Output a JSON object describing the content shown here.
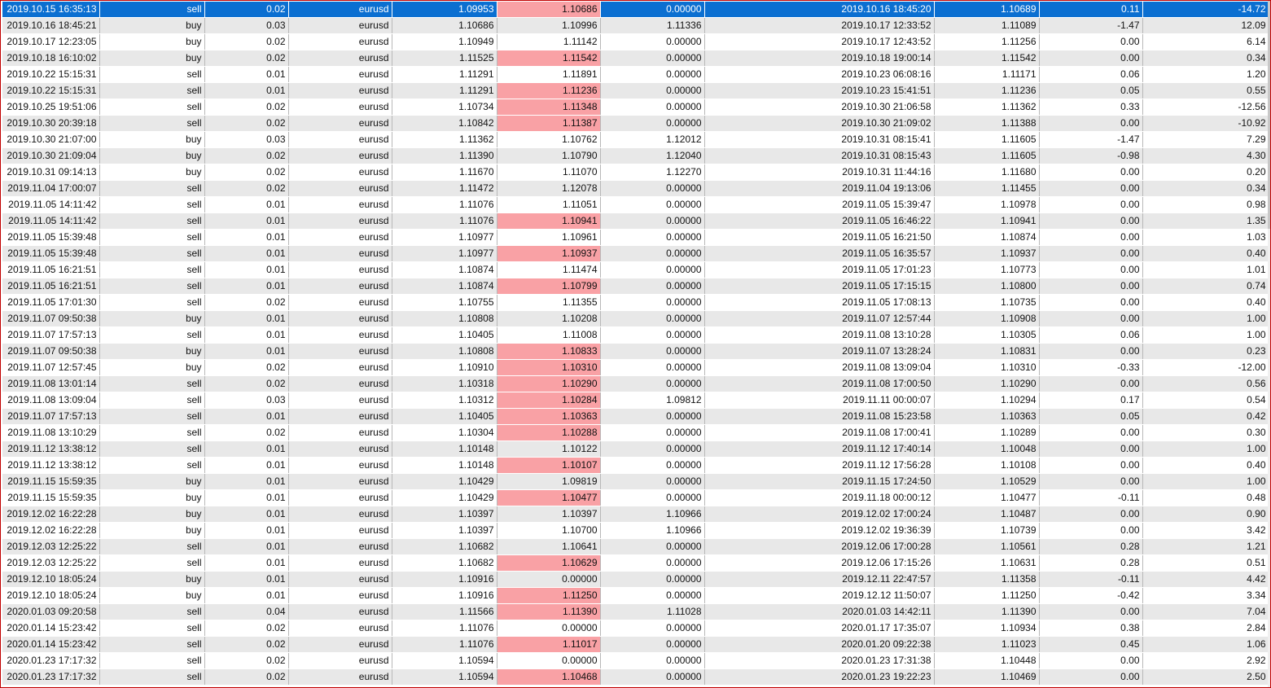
{
  "colors": {
    "selection": "#0b6fd1",
    "row_alt": "#e8e8e8",
    "row": "#ffffff",
    "highlight": "#f9a1a5",
    "frame": "#c00000"
  },
  "columns": [
    "open_time",
    "type",
    "volume",
    "symbol",
    "open_price",
    "sl",
    "tp",
    "close_time",
    "close_price",
    "swap",
    "profit"
  ],
  "selected_row": 0,
  "rows": [
    {
      "cells": [
        "2019.10.15 16:35:13",
        "sell",
        "0.02",
        "eurusd",
        "1.09953",
        "1.10686",
        "0.00000",
        "2019.10.16 18:45:20",
        "1.10689",
        "0.11",
        "-14.72"
      ],
      "hl": true
    },
    {
      "cells": [
        "2019.10.16 18:45:21",
        "buy",
        "0.03",
        "eurusd",
        "1.10686",
        "1.10996",
        "1.11336",
        "2019.10.17 12:33:52",
        "1.11089",
        "-1.47",
        "12.09"
      ],
      "hl": false
    },
    {
      "cells": [
        "2019.10.17 12:23:05",
        "buy",
        "0.02",
        "eurusd",
        "1.10949",
        "1.11142",
        "0.00000",
        "2019.10.17 12:43:52",
        "1.11256",
        "0.00",
        "6.14"
      ],
      "hl": false
    },
    {
      "cells": [
        "2019.10.18 16:10:02",
        "buy",
        "0.02",
        "eurusd",
        "1.11525",
        "1.11542",
        "0.00000",
        "2019.10.18 19:00:14",
        "1.11542",
        "0.00",
        "0.34"
      ],
      "hl": true
    },
    {
      "cells": [
        "2019.10.22 15:15:31",
        "sell",
        "0.01",
        "eurusd",
        "1.11291",
        "1.11891",
        "0.00000",
        "2019.10.23 06:08:16",
        "1.11171",
        "0.06",
        "1.20"
      ],
      "hl": false
    },
    {
      "cells": [
        "2019.10.22 15:15:31",
        "sell",
        "0.01",
        "eurusd",
        "1.11291",
        "1.11236",
        "0.00000",
        "2019.10.23 15:41:51",
        "1.11236",
        "0.05",
        "0.55"
      ],
      "hl": true
    },
    {
      "cells": [
        "2019.10.25 19:51:06",
        "sell",
        "0.02",
        "eurusd",
        "1.10734",
        "1.11348",
        "0.00000",
        "2019.10.30 21:06:58",
        "1.11362",
        "0.33",
        "-12.56"
      ],
      "hl": true
    },
    {
      "cells": [
        "2019.10.30 20:39:18",
        "sell",
        "0.02",
        "eurusd",
        "1.10842",
        "1.11387",
        "0.00000",
        "2019.10.30 21:09:02",
        "1.11388",
        "0.00",
        "-10.92"
      ],
      "hl": true
    },
    {
      "cells": [
        "2019.10.30 21:07:00",
        "buy",
        "0.03",
        "eurusd",
        "1.11362",
        "1.10762",
        "1.12012",
        "2019.10.31 08:15:41",
        "1.11605",
        "-1.47",
        "7.29"
      ],
      "hl": false
    },
    {
      "cells": [
        "2019.10.30 21:09:04",
        "buy",
        "0.02",
        "eurusd",
        "1.11390",
        "1.10790",
        "1.12040",
        "2019.10.31 08:15:43",
        "1.11605",
        "-0.98",
        "4.30"
      ],
      "hl": false
    },
    {
      "cells": [
        "2019.10.31 09:14:13",
        "buy",
        "0.02",
        "eurusd",
        "1.11670",
        "1.11070",
        "1.12270",
        "2019.10.31 11:44:16",
        "1.11680",
        "0.00",
        "0.20"
      ],
      "hl": false
    },
    {
      "cells": [
        "2019.11.04 17:00:07",
        "sell",
        "0.02",
        "eurusd",
        "1.11472",
        "1.12078",
        "0.00000",
        "2019.11.04 19:13:06",
        "1.11455",
        "0.00",
        "0.34"
      ],
      "hl": false
    },
    {
      "cells": [
        "2019.11.05 14:11:42",
        "sell",
        "0.01",
        "eurusd",
        "1.11076",
        "1.11051",
        "0.00000",
        "2019.11.05 15:39:47",
        "1.10978",
        "0.00",
        "0.98"
      ],
      "hl": false
    },
    {
      "cells": [
        "2019.11.05 14:11:42",
        "sell",
        "0.01",
        "eurusd",
        "1.11076",
        "1.10941",
        "0.00000",
        "2019.11.05 16:46:22",
        "1.10941",
        "0.00",
        "1.35"
      ],
      "hl": true
    },
    {
      "cells": [
        "2019.11.05 15:39:48",
        "sell",
        "0.01",
        "eurusd",
        "1.10977",
        "1.10961",
        "0.00000",
        "2019.11.05 16:21:50",
        "1.10874",
        "0.00",
        "1.03"
      ],
      "hl": false
    },
    {
      "cells": [
        "2019.11.05 15:39:48",
        "sell",
        "0.01",
        "eurusd",
        "1.10977",
        "1.10937",
        "0.00000",
        "2019.11.05 16:35:57",
        "1.10937",
        "0.00",
        "0.40"
      ],
      "hl": true
    },
    {
      "cells": [
        "2019.11.05 16:21:51",
        "sell",
        "0.01",
        "eurusd",
        "1.10874",
        "1.11474",
        "0.00000",
        "2019.11.05 17:01:23",
        "1.10773",
        "0.00",
        "1.01"
      ],
      "hl": false
    },
    {
      "cells": [
        "2019.11.05 16:21:51",
        "sell",
        "0.01",
        "eurusd",
        "1.10874",
        "1.10799",
        "0.00000",
        "2019.11.05 17:15:15",
        "1.10800",
        "0.00",
        "0.74"
      ],
      "hl": true
    },
    {
      "cells": [
        "2019.11.05 17:01:30",
        "sell",
        "0.02",
        "eurusd",
        "1.10755",
        "1.11355",
        "0.00000",
        "2019.11.05 17:08:13",
        "1.10735",
        "0.00",
        "0.40"
      ],
      "hl": false
    },
    {
      "cells": [
        "2019.11.07 09:50:38",
        "buy",
        "0.01",
        "eurusd",
        "1.10808",
        "1.10208",
        "0.00000",
        "2019.11.07 12:57:44",
        "1.10908",
        "0.00",
        "1.00"
      ],
      "hl": false
    },
    {
      "cells": [
        "2019.11.07 17:57:13",
        "sell",
        "0.01",
        "eurusd",
        "1.10405",
        "1.11008",
        "0.00000",
        "2019.11.08 13:10:28",
        "1.10305",
        "0.06",
        "1.00"
      ],
      "hl": false
    },
    {
      "cells": [
        "2019.11.07 09:50:38",
        "buy",
        "0.01",
        "eurusd",
        "1.10808",
        "1.10833",
        "0.00000",
        "2019.11.07 13:28:24",
        "1.10831",
        "0.00",
        "0.23"
      ],
      "hl": true
    },
    {
      "cells": [
        "2019.11.07 12:57:45",
        "buy",
        "0.02",
        "eurusd",
        "1.10910",
        "1.10310",
        "0.00000",
        "2019.11.08 13:09:04",
        "1.10310",
        "-0.33",
        "-12.00"
      ],
      "hl": true
    },
    {
      "cells": [
        "2019.11.08 13:01:14",
        "sell",
        "0.02",
        "eurusd",
        "1.10318",
        "1.10290",
        "0.00000",
        "2019.11.08 17:00:50",
        "1.10290",
        "0.00",
        "0.56"
      ],
      "hl": true
    },
    {
      "cells": [
        "2019.11.08 13:09:04",
        "sell",
        "0.03",
        "eurusd",
        "1.10312",
        "1.10284",
        "1.09812",
        "2019.11.11 00:00:07",
        "1.10294",
        "0.17",
        "0.54"
      ],
      "hl": true
    },
    {
      "cells": [
        "2019.11.07 17:57:13",
        "sell",
        "0.01",
        "eurusd",
        "1.10405",
        "1.10363",
        "0.00000",
        "2019.11.08 15:23:58",
        "1.10363",
        "0.05",
        "0.42"
      ],
      "hl": true
    },
    {
      "cells": [
        "2019.11.08 13:10:29",
        "sell",
        "0.02",
        "eurusd",
        "1.10304",
        "1.10288",
        "0.00000",
        "2019.11.08 17:00:41",
        "1.10289",
        "0.00",
        "0.30"
      ],
      "hl": true
    },
    {
      "cells": [
        "2019.11.12 13:38:12",
        "sell",
        "0.01",
        "eurusd",
        "1.10148",
        "1.10122",
        "0.00000",
        "2019.11.12 17:40:14",
        "1.10048",
        "0.00",
        "1.00"
      ],
      "hl": false
    },
    {
      "cells": [
        "2019.11.12 13:38:12",
        "sell",
        "0.01",
        "eurusd",
        "1.10148",
        "1.10107",
        "0.00000",
        "2019.11.12 17:56:28",
        "1.10108",
        "0.00",
        "0.40"
      ],
      "hl": true
    },
    {
      "cells": [
        "2019.11.15 15:59:35",
        "buy",
        "0.01",
        "eurusd",
        "1.10429",
        "1.09819",
        "0.00000",
        "2019.11.15 17:24:50",
        "1.10529",
        "0.00",
        "1.00"
      ],
      "hl": false
    },
    {
      "cells": [
        "2019.11.15 15:59:35",
        "buy",
        "0.01",
        "eurusd",
        "1.10429",
        "1.10477",
        "0.00000",
        "2019.11.18 00:00:12",
        "1.10477",
        "-0.11",
        "0.48"
      ],
      "hl": true
    },
    {
      "cells": [
        "2019.12.02 16:22:28",
        "buy",
        "0.01",
        "eurusd",
        "1.10397",
        "1.10397",
        "1.10966",
        "2019.12.02 17:00:24",
        "1.10487",
        "0.00",
        "0.90"
      ],
      "hl": false
    },
    {
      "cells": [
        "2019.12.02 16:22:28",
        "buy",
        "0.01",
        "eurusd",
        "1.10397",
        "1.10700",
        "1.10966",
        "2019.12.02 19:36:39",
        "1.10739",
        "0.00",
        "3.42"
      ],
      "hl": false
    },
    {
      "cells": [
        "2019.12.03 12:25:22",
        "sell",
        "0.01",
        "eurusd",
        "1.10682",
        "1.10641",
        "0.00000",
        "2019.12.06 17:00:28",
        "1.10561",
        "0.28",
        "1.21"
      ],
      "hl": false
    },
    {
      "cells": [
        "2019.12.03 12:25:22",
        "sell",
        "0.01",
        "eurusd",
        "1.10682",
        "1.10629",
        "0.00000",
        "2019.12.06 17:15:26",
        "1.10631",
        "0.28",
        "0.51"
      ],
      "hl": true
    },
    {
      "cells": [
        "2019.12.10 18:05:24",
        "buy",
        "0.01",
        "eurusd",
        "1.10916",
        "0.00000",
        "0.00000",
        "2019.12.11 22:47:57",
        "1.11358",
        "-0.11",
        "4.42"
      ],
      "hl": false
    },
    {
      "cells": [
        "2019.12.10 18:05:24",
        "buy",
        "0.01",
        "eurusd",
        "1.10916",
        "1.11250",
        "0.00000",
        "2019.12.12 11:50:07",
        "1.11250",
        "-0.42",
        "3.34"
      ],
      "hl": true
    },
    {
      "cells": [
        "2020.01.03 09:20:58",
        "sell",
        "0.04",
        "eurusd",
        "1.11566",
        "1.11390",
        "1.11028",
        "2020.01.03 14:42:11",
        "1.11390",
        "0.00",
        "7.04"
      ],
      "hl": true
    },
    {
      "cells": [
        "2020.01.14 15:23:42",
        "sell",
        "0.02",
        "eurusd",
        "1.11076",
        "0.00000",
        "0.00000",
        "2020.01.17 17:35:07",
        "1.10934",
        "0.38",
        "2.84"
      ],
      "hl": false
    },
    {
      "cells": [
        "2020.01.14 15:23:42",
        "sell",
        "0.02",
        "eurusd",
        "1.11076",
        "1.11017",
        "0.00000",
        "2020.01.20 09:22:38",
        "1.11023",
        "0.45",
        "1.06"
      ],
      "hl": true
    },
    {
      "cells": [
        "2020.01.23 17:17:32",
        "sell",
        "0.02",
        "eurusd",
        "1.10594",
        "0.00000",
        "0.00000",
        "2020.01.23 17:31:38",
        "1.10448",
        "0.00",
        "2.92"
      ],
      "hl": false
    },
    {
      "cells": [
        "2020.01.23 17:17:32",
        "sell",
        "0.02",
        "eurusd",
        "1.10594",
        "1.10468",
        "0.00000",
        "2020.01.23 19:22:23",
        "1.10469",
        "0.00",
        "2.50"
      ],
      "hl": true
    }
  ]
}
